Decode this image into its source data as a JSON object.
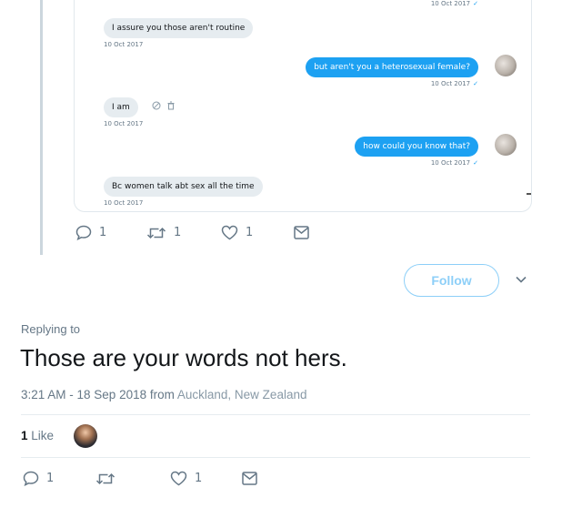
{
  "dm": {
    "messages": [
      {
        "direction": "sent",
        "text": "",
        "stamp": "10 Oct 2017"
      },
      {
        "direction": "received",
        "text": "I assure you those aren't routine",
        "stamp": "10 Oct 2017"
      },
      {
        "direction": "sent",
        "text": "but aren't you a heterosexual female?",
        "stamp": "10 Oct 2017"
      },
      {
        "direction": "received",
        "text": "I am",
        "stamp": "10 Oct 2017"
      },
      {
        "direction": "sent",
        "text": "how could you know that?",
        "stamp": "10 Oct 2017"
      },
      {
        "direction": "received",
        "text": "Bc women talk abt sex all the time",
        "stamp": "10 Oct 2017"
      }
    ],
    "check_glyph": "✓",
    "inline_icons": [
      "block-icon",
      "trash-icon"
    ]
  },
  "quoted_actions": {
    "reply_count": "1",
    "retweet_count": "1",
    "like_count": "1"
  },
  "follow": {
    "label": "Follow"
  },
  "tweet": {
    "replying_to": "Replying to",
    "text": "Those are your words not hers.",
    "time": "3:21 AM - 18 Sep 2018",
    "from_word": "from",
    "location": "Auckland, New Zealand"
  },
  "stats": {
    "like_count": "1",
    "like_label": "Like"
  },
  "bottom_actions": {
    "reply_count": "1",
    "retweet_count": "",
    "like_count": "1"
  },
  "colors": {
    "accent": "#1da1f2",
    "muted": "#657786",
    "bubble_in": "#e6ecf0"
  }
}
